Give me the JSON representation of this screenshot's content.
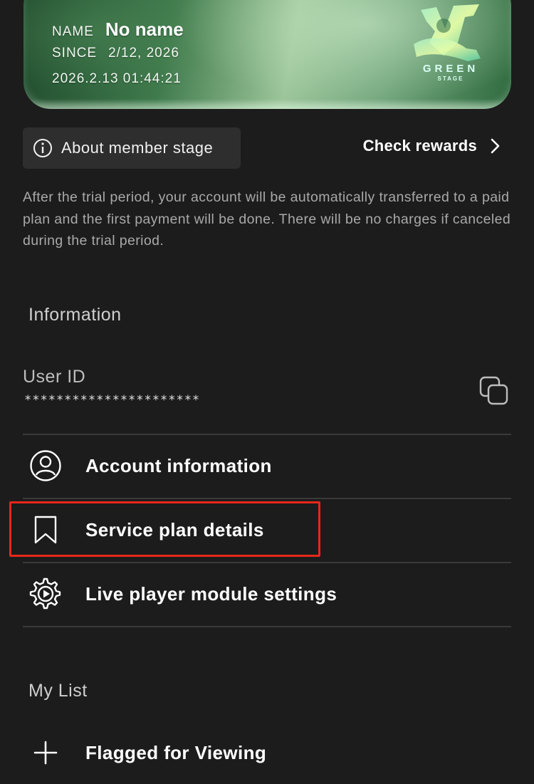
{
  "card": {
    "name_label": "NAME",
    "name_value": "No name",
    "since_label": "SINCE",
    "since_value": "2/12, 2026",
    "timestamp": "2026.2.13 01:44:21",
    "logo_word": "GREEN",
    "logo_sub": "STAGE"
  },
  "about": {
    "label": "About member stage",
    "icon": "info-icon"
  },
  "rewards": {
    "label": "Check rewards",
    "icon": "chevron-right-icon"
  },
  "notice": "After the trial period, your account will be automatically transferred to a paid plan and the first payment will be done. There will be no charges if canceled during the trial period.",
  "information": {
    "title": "Information",
    "user_id_label": "User ID",
    "user_id_value": "**********************",
    "copy_icon": "copy-icon",
    "items": [
      {
        "label": "Account information",
        "icon": "user-circle-icon"
      },
      {
        "label": "Service plan details",
        "icon": "bookmark-icon"
      },
      {
        "label": "Live player module settings",
        "icon": "gear-play-icon"
      }
    ]
  },
  "my_list": {
    "title": "My List",
    "items": [
      {
        "label": "Flagged for Viewing",
        "icon": "plus-icon"
      }
    ]
  },
  "colors": {
    "background": "#1c1c1c",
    "highlight": "#e8271a"
  }
}
